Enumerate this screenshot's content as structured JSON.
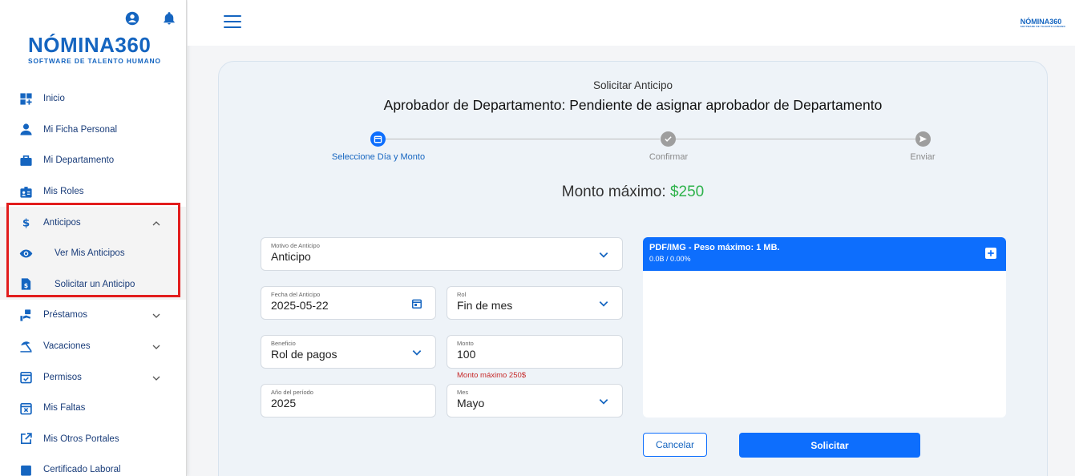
{
  "sidebar": {
    "logo_main": "NÓMINA360",
    "logo_sub": "SOFTWARE DE TALENTO HUMANO",
    "items": [
      {
        "label": "Inicio"
      },
      {
        "label": "Mi Ficha Personal"
      },
      {
        "label": "Mi Departamento"
      },
      {
        "label": "Mis Roles"
      },
      {
        "label": "Anticipos"
      },
      {
        "label": "Ver Mis Anticipos"
      },
      {
        "label": "Solicitar un Anticipo"
      },
      {
        "label": "Préstamos"
      },
      {
        "label": "Vacaciones"
      },
      {
        "label": "Permisos"
      },
      {
        "label": "Mis Faltas"
      },
      {
        "label": "Mis Otros Portales"
      },
      {
        "label": "Certificado Laboral"
      }
    ]
  },
  "topbar": {
    "mini_logo": "NÓMINA360",
    "mini_logo_sub": "SOFTWARE DE TALENTO HUMANO"
  },
  "form": {
    "subtitle": "Solicitar Anticipo",
    "title": "Aprobador de Departamento: Pendiente de asignar aprobador de Departamento",
    "steps": [
      {
        "label": "Seleccione Día y Monto"
      },
      {
        "label": "Confirmar"
      },
      {
        "label": "Enviar"
      }
    ],
    "monto_label": "Monto máximo:",
    "monto_value": "$250",
    "motivo": {
      "label": "Motivo de Anticipo",
      "value": "Anticipo"
    },
    "fecha": {
      "label": "Fecha del Anticipo",
      "value": "2025-05-22"
    },
    "rol": {
      "label": "Rol",
      "value": "Fin de mes"
    },
    "beneficio": {
      "label": "Beneficio",
      "value": "Rol de pagos"
    },
    "monto": {
      "label": "Monto",
      "value": "100",
      "helper": "Monto máximo 250$"
    },
    "anio": {
      "label": "Año del período",
      "value": "2025"
    },
    "mes": {
      "label": "Mes",
      "value": "Mayo"
    },
    "upload": {
      "title": "PDF/IMG - Peso máximo: 1 MB.",
      "status": "0.0B / 0.00%"
    },
    "cancel_label": "Cancelar",
    "submit_label": "Solicitar"
  },
  "colors": {
    "brand": "#1565c0",
    "primary": "#0d6efd",
    "success": "#2eb24b",
    "error": "#c62828",
    "highlight": "#e21d1d"
  }
}
